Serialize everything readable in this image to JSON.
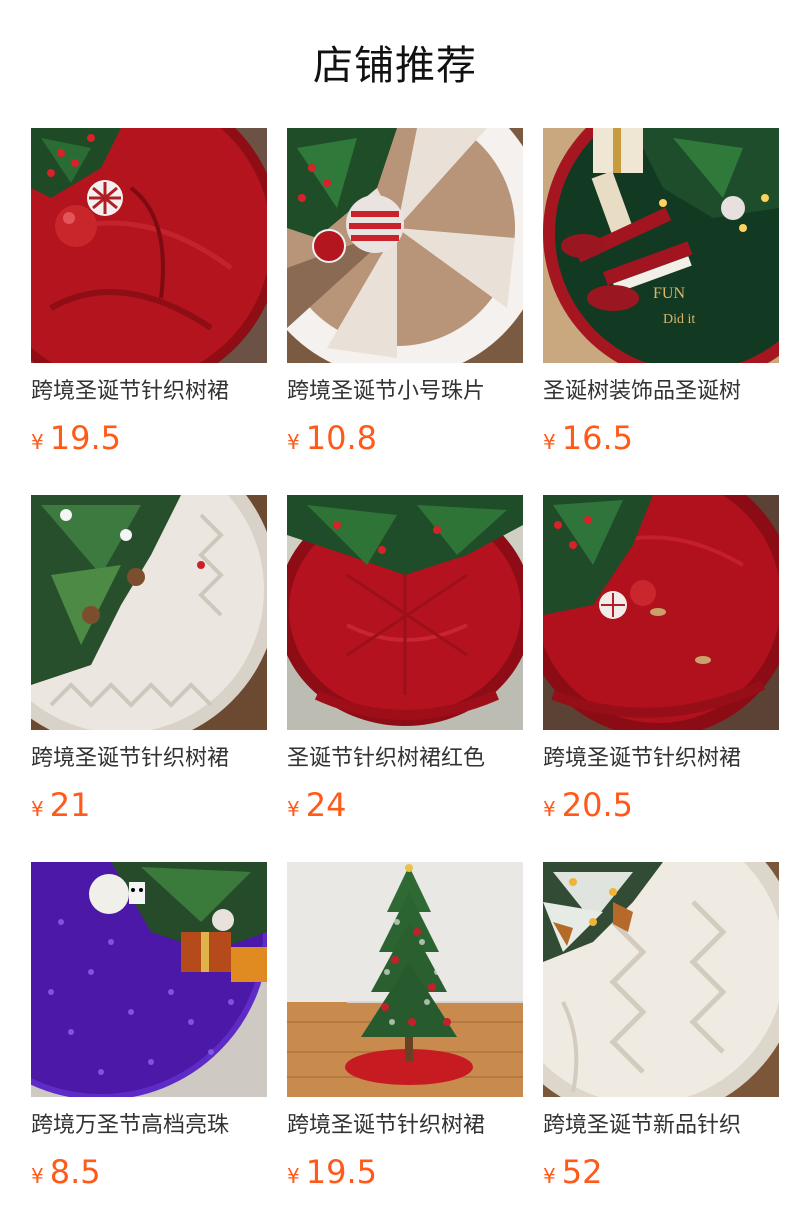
{
  "header": {
    "title": "店铺推荐"
  },
  "products": [
    {
      "name": "跨境圣诞节针织树裙",
      "currency": "¥",
      "price": "19.5",
      "image_icon": "red-knit-tree-skirt-image"
    },
    {
      "name": "跨境圣诞节小号珠片",
      "currency": "¥",
      "price": "10.8",
      "image_icon": "sequin-tree-skirt-image"
    },
    {
      "name": "圣诞树装饰品圣诞树",
      "currency": "¥",
      "price": "16.5",
      "image_icon": "elf-tree-skirt-image"
    },
    {
      "name": "跨境圣诞节针织树裙",
      "currency": "¥",
      "price": "21",
      "image_icon": "white-knit-tree-skirt-image"
    },
    {
      "name": "圣诞节针织树裙红色",
      "currency": "¥",
      "price": "24",
      "image_icon": "red-cable-tree-skirt-image"
    },
    {
      "name": "跨境圣诞节针织树裙",
      "currency": "¥",
      "price": "20.5",
      "image_icon": "red-knit-buttons-tree-skirt-image"
    },
    {
      "name": "跨境万圣节高档亮珠",
      "currency": "¥",
      "price": "8.5",
      "image_icon": "purple-sequin-tree-skirt-image"
    },
    {
      "name": "跨境圣诞节针织树裙",
      "currency": "¥",
      "price": "19.5",
      "image_icon": "mini-tree-red-skirt-image"
    },
    {
      "name": "跨境圣诞节新品针织",
      "currency": "¥",
      "price": "52",
      "image_icon": "cream-cable-tree-skirt-image"
    }
  ],
  "colors": {
    "price": "#ff5a1a",
    "title": "#111111",
    "name": "#333333"
  }
}
